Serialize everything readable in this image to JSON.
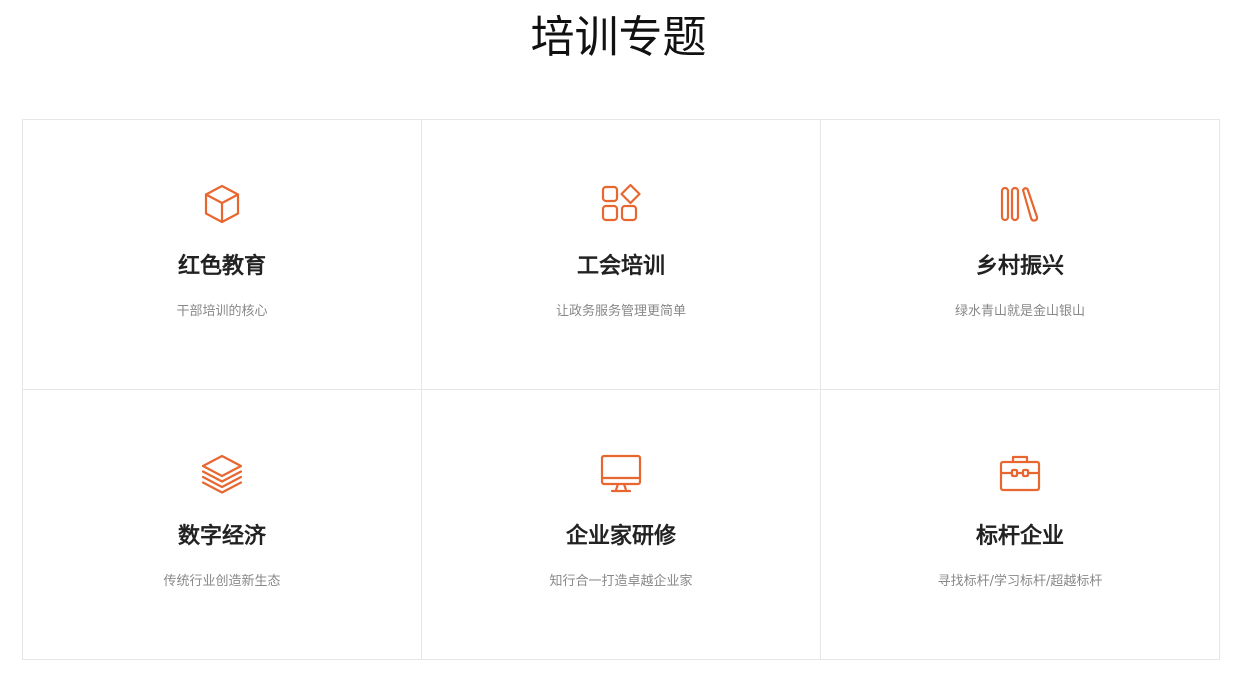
{
  "header": {
    "title": "培训专题"
  },
  "colors": {
    "accent": "#e8662f",
    "border": "#e6e6e6",
    "subtitle": "#888888"
  },
  "cards": [
    {
      "icon": "cube-icon",
      "title": "红色教育",
      "subtitle": "干部培训的核心"
    },
    {
      "icon": "apps-grid-icon",
      "title": "工会培训",
      "subtitle": "让政务服务管理更简单"
    },
    {
      "icon": "books-icon",
      "title": "乡村振兴",
      "subtitle": "绿水青山就是金山银山"
    },
    {
      "icon": "layers-icon",
      "title": "数字经济",
      "subtitle": "传统行业创造新生态"
    },
    {
      "icon": "monitor-icon",
      "title": "企业家研修",
      "subtitle": "知行合一打造卓越企业家"
    },
    {
      "icon": "toolbox-icon",
      "title": "标杆企业",
      "subtitle": "寻找标杆/学习标杆/超越标杆"
    }
  ]
}
